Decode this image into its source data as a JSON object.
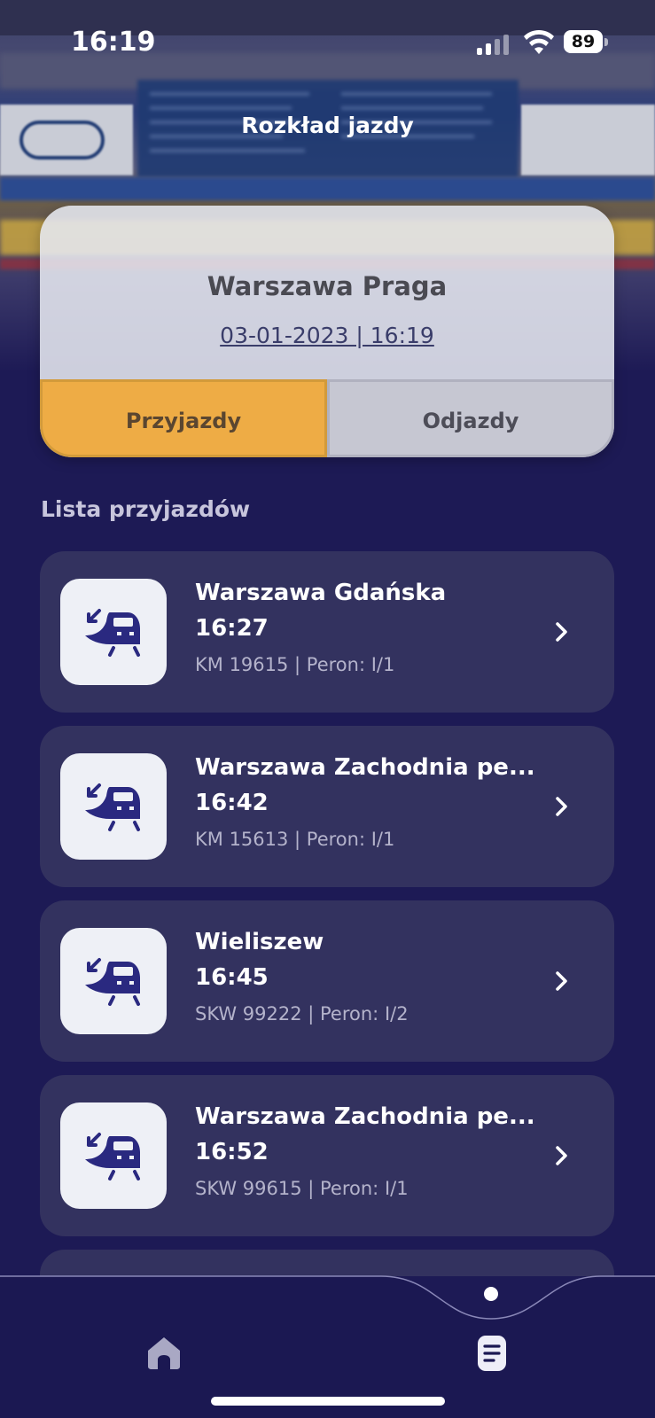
{
  "status_bar": {
    "time": "16:19",
    "battery": "89"
  },
  "header": {
    "title": "Rozkład jazdy"
  },
  "station": {
    "name": "Warszawa Praga",
    "datetime": "03-01-2023  |  16:19"
  },
  "tabs": [
    {
      "label": "Przyjazdy",
      "active": true
    },
    {
      "label": "Odjazdy",
      "active": false
    }
  ],
  "list": {
    "title": "Lista przyjazdów",
    "items": [
      {
        "destination": "Warszawa Gdańska",
        "time": "16:27",
        "meta": "KM 19615 | Peron: I/1",
        "icon": "arriving-train-icon"
      },
      {
        "destination": "Warszawa Zachodnia pe...",
        "time": "16:42",
        "meta": "KM 15613 | Peron: I/1",
        "icon": "arriving-train-icon"
      },
      {
        "destination": "Wieliszew",
        "time": "16:45",
        "meta": "SKW 99222 | Peron: I/2",
        "icon": "arriving-train-icon"
      },
      {
        "destination": "Warszawa Zachodnia pe...",
        "time": "16:52",
        "meta": "SKW 99615 | Peron: I/1",
        "icon": "arriving-train-icon"
      }
    ]
  },
  "bottom_nav": {
    "items": [
      "home-icon",
      "timetable-list-icon"
    ],
    "active": "timetable-list-icon"
  },
  "colors": {
    "background": "#1d1a55",
    "card": "#33325f",
    "accent": "#eeac45"
  }
}
